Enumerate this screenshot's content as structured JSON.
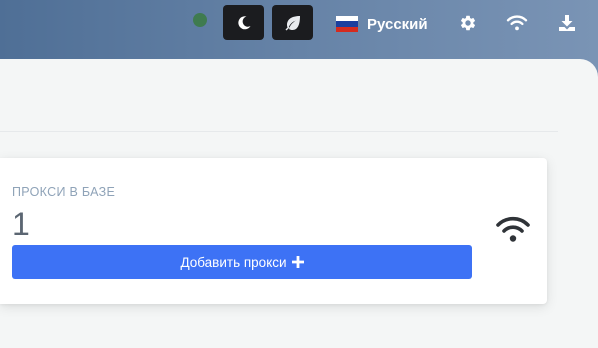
{
  "header": {
    "status_indicator": "online",
    "theme_buttons": [
      {
        "name": "moon-icon"
      },
      {
        "name": "leaf-icon"
      }
    ],
    "language": {
      "label": "Русский",
      "flag_colors": [
        "#ffffff",
        "#1c3f9e",
        "#d52b1e"
      ]
    },
    "icons": [
      "gear-icon",
      "wifi-icon",
      "download-icon"
    ]
  },
  "card": {
    "title": "ПРОКСИ В БАЗЕ",
    "value": "1",
    "button_label": "Добавить прокси",
    "button_icon": "plus-icon",
    "side_icon": "wifi-icon"
  },
  "colors": {
    "accent": "#3d72f5",
    "status_dot": "#3f7b4f",
    "dark_button": "#1b1c1f"
  }
}
